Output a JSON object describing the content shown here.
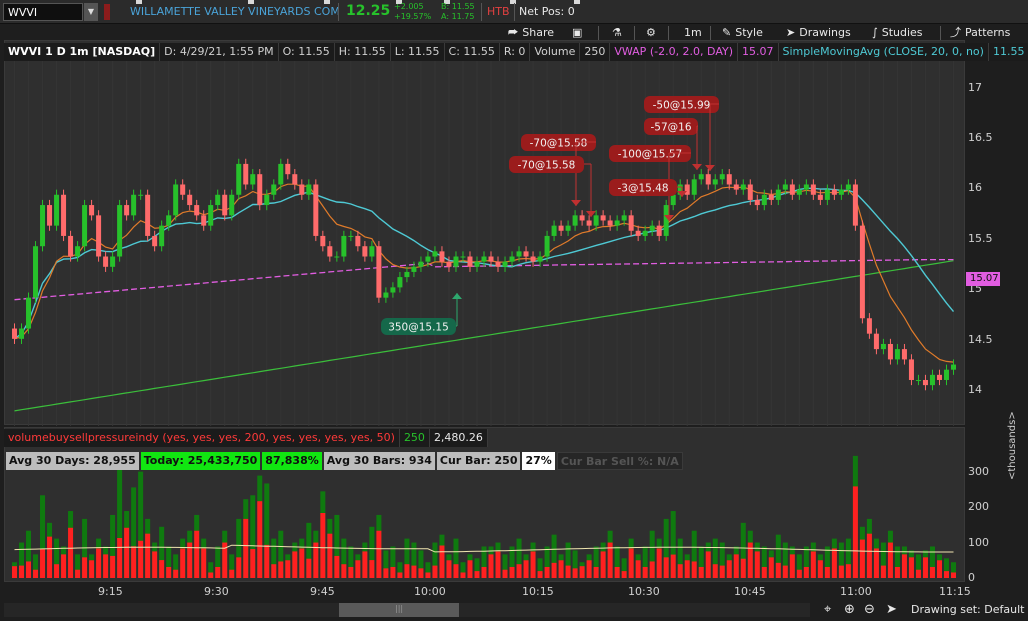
{
  "header": {
    "symbol": "WVVI",
    "company": "WILLAMETTE VALLEY VINEYARDS COM",
    "last_price": "12.25",
    "change_net": "+2.005",
    "change_pct": "+19.57%",
    "bid": "B: 11.55",
    "ask": "A: 11.75",
    "htb": "HTB",
    "net_pos": "Net Pos: 0",
    "buttons": {
      "share": "Share",
      "timeframe": "1m",
      "style": "Style",
      "drawings": "Drawings",
      "studies": "Studies",
      "patterns": "Patterns"
    }
  },
  "price_panel": {
    "title": "WVVI 1 D 1m [NASDAQ]",
    "date": "D: 4/29/21, 1:55 PM",
    "open": "O: 11.55",
    "high": "H: 11.55",
    "low": "L: 11.55",
    "close": "C: 11.55",
    "range": "R: 0",
    "volume_label": "Volume",
    "volume_value": "250",
    "vwap_label": "VWAP (-2.0, 2.0, DAY)",
    "vwap_value": "15.07",
    "sma_label": "SimpleMovingAvg (CLOSE, 20, 0, no)",
    "sma_value": "11.55",
    "y_ticks": [
      "17",
      "16.5",
      "16",
      "15.5",
      "15",
      "14.5",
      "14"
    ],
    "vwap_tag": "15.07"
  },
  "study_panel": {
    "title": "volumebuysellpressureindy (yes, yes, yes, 200, yes, yes, yes, yes, 50)",
    "value1": "250",
    "value2": "2,480.26",
    "stats": {
      "avg30days": "Avg 30 Days: 28,955",
      "today": "Today: 25,433,750",
      "today_pct": "87,838%",
      "avg30bars": "Avg 30 Bars: 934",
      "curbar": "Cur Bar: 250",
      "curbar_pct": "27%",
      "sellpct": "Cur Bar Sell %: N/A"
    },
    "y_ticks": [
      "300",
      "200",
      "100",
      "0"
    ],
    "units": "<thousands>"
  },
  "x_axis": [
    "9:15",
    "9:30",
    "9:45",
    "10:00",
    "10:15",
    "10:30",
    "10:45",
    "11:00",
    "11:15"
  ],
  "footer": {
    "drawing_set": "Drawing set: Default"
  },
  "trades": [
    {
      "label": "350@15.15",
      "side": "buy"
    },
    {
      "label": "-70@15.58",
      "side": "sell"
    },
    {
      "label": "-70@15.58",
      "side": "sell"
    },
    {
      "label": "-100@15.57",
      "side": "sell"
    },
    {
      "label": "-3@15.48",
      "side": "sell"
    },
    {
      "label": "-57@16",
      "side": "sell"
    },
    {
      "label": "-50@15.99",
      "side": "sell"
    }
  ],
  "colors": {
    "up": "#27c12b",
    "down": "#ff6b6b",
    "vwap": "#e15de1",
    "sma": "#4ec9d4",
    "ema_fast": "#e07b2a",
    "ma_slow": "#3bbf3b",
    "trade_sell": "#9b1c1c",
    "trade_buy": "#15684a"
  },
  "chart_data": {
    "type": "candlestick",
    "price_range": [
      13.75,
      17.2
    ],
    "volume_range": [
      0,
      330
    ],
    "open": [
      14.6,
      14.5,
      14.6,
      14.9,
      15.4,
      15.8,
      15.6,
      15.9,
      15.5,
      15.3,
      15.4,
      15.8,
      15.7,
      15.3,
      15.2,
      15.3,
      15.8,
      15.7,
      15.9,
      15.9,
      15.5,
      15.4,
      15.6,
      15.7,
      16.0,
      15.9,
      15.8,
      15.7,
      15.6,
      15.8,
      15.9,
      15.7,
      15.9,
      16.2,
      16.0,
      16.1,
      15.8,
      15.9,
      16.0,
      16.2,
      16.1,
      16.0,
      15.9,
      16.0,
      15.5,
      15.4,
      15.3,
      15.3,
      15.5,
      15.5,
      15.4,
      15.3,
      15.4,
      14.9,
      14.95,
      15.0,
      15.1,
      15.15,
      15.2,
      15.25,
      15.3,
      15.35,
      15.25,
      15.2,
      15.3,
      15.3,
      15.2,
      15.25,
      15.3,
      15.25,
      15.2,
      15.25,
      15.3,
      15.35,
      15.3,
      15.25,
      15.3,
      15.5,
      15.6,
      15.55,
      15.6,
      15.7,
      15.65,
      15.6,
      15.7,
      15.65,
      15.6,
      15.65,
      15.7,
      15.55,
      15.5,
      15.55,
      15.6,
      15.5,
      15.8,
      15.9,
      16.0,
      15.9,
      16.05,
      16.1,
      16.0,
      16.05,
      16.1,
      16.0,
      15.95,
      16.0,
      15.85,
      15.8,
      15.9,
      15.85,
      15.95,
      16.0,
      15.9,
      15.95,
      16.0,
      15.9,
      15.85,
      15.95,
      15.9,
      15.95,
      16.0,
      15.6,
      14.7,
      14.55,
      14.4,
      14.45,
      14.3,
      14.4,
      14.3,
      14.1,
      14.1,
      14.05,
      14.15,
      14.1,
      14.2
    ],
    "close": [
      14.5,
      14.6,
      14.9,
      15.4,
      15.8,
      15.6,
      15.9,
      15.5,
      15.3,
      15.4,
      15.8,
      15.7,
      15.3,
      15.2,
      15.3,
      15.8,
      15.7,
      15.9,
      15.9,
      15.5,
      15.4,
      15.6,
      15.7,
      16.0,
      15.9,
      15.8,
      15.7,
      15.6,
      15.8,
      15.9,
      15.7,
      15.9,
      16.2,
      16.0,
      16.1,
      15.8,
      15.9,
      16.0,
      16.2,
      16.1,
      16.0,
      15.9,
      16.0,
      15.5,
      15.4,
      15.3,
      15.3,
      15.5,
      15.5,
      15.4,
      15.3,
      15.4,
      14.9,
      14.95,
      15.0,
      15.1,
      15.15,
      15.2,
      15.25,
      15.3,
      15.35,
      15.25,
      15.2,
      15.3,
      15.3,
      15.2,
      15.25,
      15.3,
      15.25,
      15.2,
      15.25,
      15.3,
      15.35,
      15.3,
      15.25,
      15.3,
      15.5,
      15.6,
      15.55,
      15.6,
      15.7,
      15.65,
      15.6,
      15.7,
      15.65,
      15.6,
      15.65,
      15.7,
      15.55,
      15.5,
      15.55,
      15.6,
      15.5,
      15.8,
      15.9,
      16.0,
      15.9,
      16.05,
      16.1,
      16.0,
      16.05,
      16.1,
      16.0,
      15.95,
      16.0,
      15.85,
      15.8,
      15.9,
      15.85,
      15.95,
      16.0,
      15.9,
      15.95,
      16.0,
      15.9,
      15.85,
      15.95,
      15.9,
      15.95,
      16.0,
      15.6,
      14.7,
      14.55,
      14.4,
      14.45,
      14.3,
      14.4,
      14.3,
      14.1,
      14.1,
      14.05,
      14.15,
      14.1,
      14.2,
      14.25
    ],
    "volume": [
      40,
      90,
      120,
      60,
      210,
      140,
      100,
      80,
      170,
      60,
      150,
      60,
      100,
      80,
      160,
      290,
      170,
      230,
      270,
      150,
      90,
      130,
      80,
      60,
      100,
      120,
      160,
      100,
      40,
      80,
      120,
      60,
      150,
      200,
      210,
      260,
      240,
      100,
      120,
      60,
      90,
      100,
      140,
      120,
      220,
      150,
      160,
      100,
      80,
      60,
      90,
      130,
      160,
      70,
      80,
      40,
      100,
      90,
      70,
      40,
      90,
      110,
      60,
      100,
      40,
      60,
      50,
      80,
      80,
      90,
      60,
      80,
      100,
      60,
      90,
      50,
      80,
      110,
      60,
      90,
      70,
      40,
      60,
      80,
      90,
      120,
      80,
      50,
      100,
      60,
      80,
      120,
      100,
      150,
      170,
      100,
      60,
      120,
      80,
      90,
      100,
      90,
      60,
      80,
      140,
      120,
      90,
      80,
      70,
      110,
      90,
      80,
      60,
      80,
      90,
      60,
      80,
      100,
      90,
      100,
      310,
      130,
      150,
      100,
      90,
      120,
      80,
      80,
      70,
      60,
      70,
      80,
      60,
      50,
      40
    ],
    "x_labels": [
      "9:15",
      "9:30",
      "9:45",
      "10:00",
      "10:15",
      "10:30",
      "10:45",
      "11:00",
      "11:15"
    ]
  }
}
